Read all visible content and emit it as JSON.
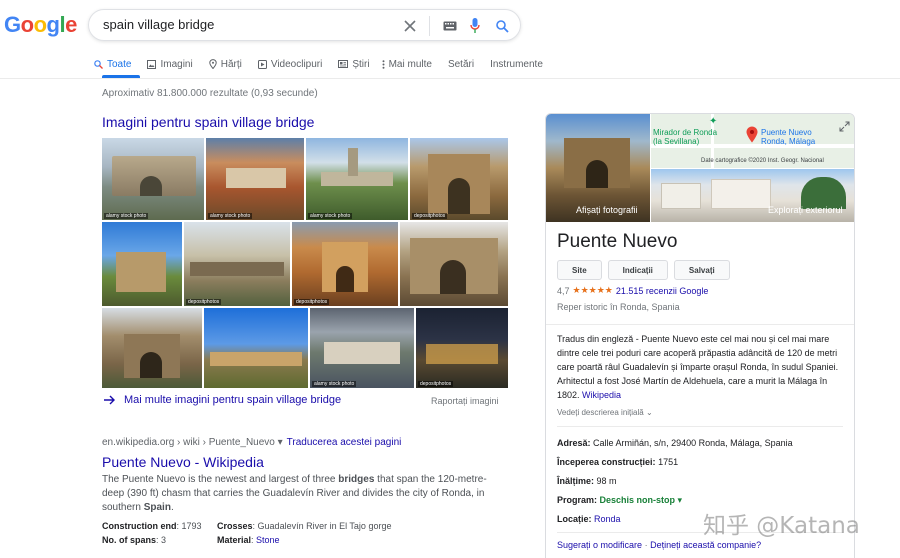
{
  "logo": {
    "letters": [
      "G",
      "o",
      "o",
      "g",
      "l",
      "e"
    ],
    "colors": [
      "#4285F4",
      "#EA4335",
      "#FBBC05",
      "#4285F4",
      "#34A853",
      "#EA4335"
    ]
  },
  "search": {
    "query": "spain village bridge",
    "icons": [
      "close-icon",
      "keyboard-icon",
      "microphone-icon",
      "search-icon"
    ]
  },
  "tabs": [
    {
      "label": "Toate",
      "icon": "search-icon"
    },
    {
      "label": "Imagini",
      "icon": "image-icon"
    },
    {
      "label": "Hărți",
      "icon": "map-pin-icon"
    },
    {
      "label": "Videoclipuri",
      "icon": "play-icon"
    },
    {
      "label": "Știri",
      "icon": "news-icon"
    },
    {
      "label": "Mai multe",
      "icon": "more-vert-icon"
    },
    {
      "label": "Setări"
    },
    {
      "label": "Instrumente"
    }
  ],
  "stats": "Aproximativ 81.800.000 rezultate (0,93 secunde)",
  "images": {
    "heading": "Imagini pentru spain village bridge",
    "captions": [
      "alamy stock photo",
      "alamy stock photo",
      "alamy stock photo",
      "depositphotos",
      "depositphotos",
      "depositphotos",
      "alamy stock photo",
      "depositphotos"
    ],
    "more_label": "Mai multe imagini pentru spain village bridge",
    "report_label": "Raportați imagini"
  },
  "result": {
    "cite": "en.wikipedia.org › wiki › Puente_Nuevo ▾",
    "translate": "Traducerea acestei pagini",
    "title": "Puente Nuevo - Wikipedia",
    "snippet_parts": [
      "The Puente Nuevo is the newest and largest of three ",
      "bridges",
      " that span the 120-metre-deep (390 ft) chasm that carries the Guadalevín River and divides the city of Ronda, in southern ",
      "Spain",
      "."
    ],
    "facts": {
      "construction_end_label": "Construction end",
      "construction_end": "1793",
      "crosses_label": "Crosses",
      "crosses": "Guadalevín River in El Tajo gorge",
      "spans_label": "No. of spans",
      "spans": "3",
      "material_label": "Material",
      "material": "Stone"
    }
  },
  "panel": {
    "photos_label": "Afișați fotografii",
    "street_label": "Explorați exteriorul",
    "map": {
      "label_mirador_1": "Mirador de Ronda",
      "label_mirador_2": "(la Sevillana)",
      "label_puente_1": "Puente Nuevo",
      "label_puente_2": "Ronda, Málaga",
      "attribution": "Date cartografice ©2020 Inst. Geogr. Nacional"
    },
    "title": "Puente Nuevo",
    "buttons": [
      "Site",
      "Indicații",
      "Salvați"
    ],
    "rating": {
      "value": "4,7",
      "stars": "★★★★★",
      "count": "21.515 recenzii Google"
    },
    "type": "Reper istoric în Ronda, Spania",
    "description": "Tradus din engleză - Puente Nuevo este cel mai nou și cel mai mare dintre cele trei poduri care acoperă prăpastia adâncită de 120 de metri care poartă râul Guadalevín și împarte orașul Ronda, în sudul Spaniei. Arhitectul a fost José Martín de Aldehuela, care a murit la Málaga în 1802.",
    "desc_source": "Wikipedia",
    "show_original": "Vedeți descrierea inițială",
    "facts": {
      "address_label": "Adresă:",
      "address": "Calle Armiñán, s/n, 29400 Ronda, Málaga, Spania",
      "construction_label": "Începerea construcției:",
      "construction": "1751",
      "height_label": "Înălțime:",
      "height": "98 m",
      "schedule_label": "Program:",
      "schedule": "Deschis non-stop ▾",
      "location_label": "Locație:",
      "location": "Ronda"
    },
    "footer_suggest": "Sugerați o modificare",
    "footer_sep": "·",
    "footer_own": "Dețineți această companie?"
  },
  "watermark": "知乎 @Katana"
}
